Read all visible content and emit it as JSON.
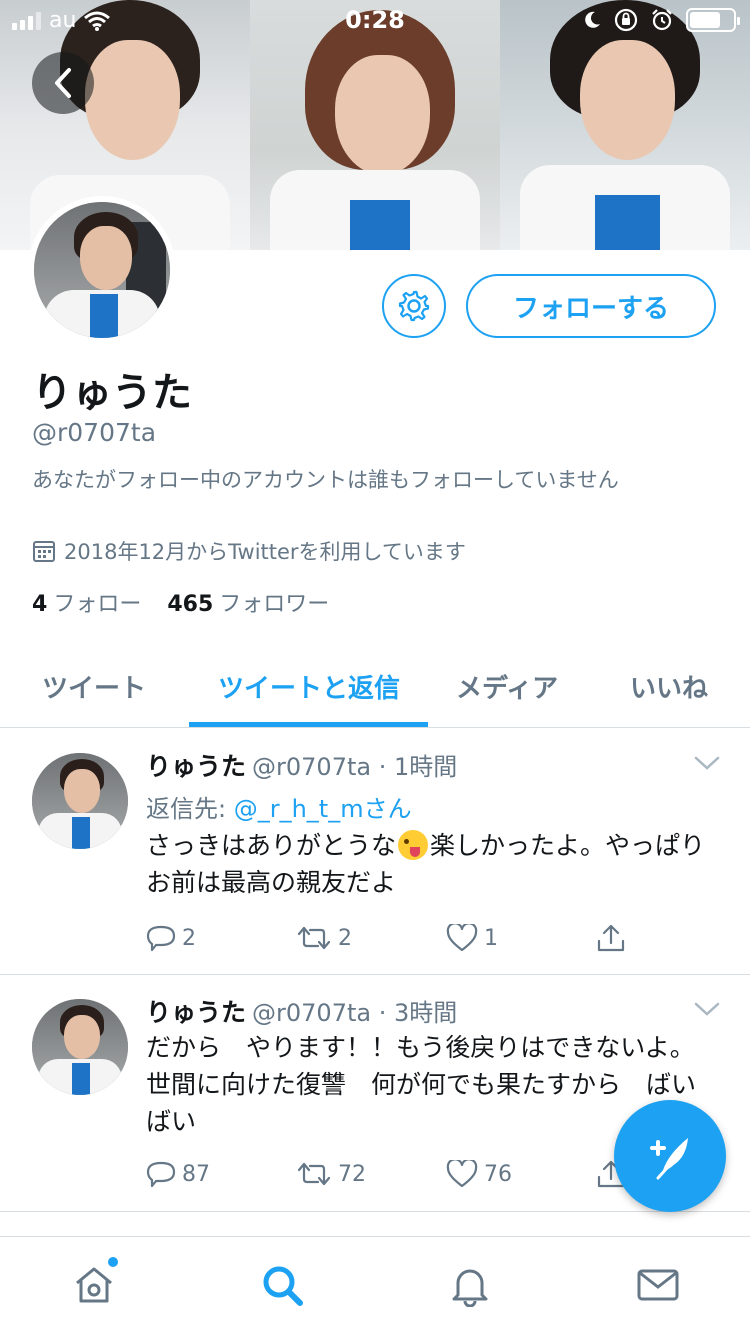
{
  "status_bar": {
    "carrier": "au",
    "time": "0:28"
  },
  "profile": {
    "display_name": "りゅうた",
    "handle": "@r0707ta",
    "follow_note": "あなたがフォロー中のアカウントは誰もフォローしていません",
    "joined": "2018年12月からTwitterを利用しています",
    "following_count": "4",
    "following_label": "フォロー",
    "followers_count": "465",
    "followers_label": "フォロワー",
    "follow_button": "フォローする"
  },
  "tabs": [
    {
      "label": "ツイート"
    },
    {
      "label": "ツイートと返信"
    },
    {
      "label": "メディア"
    },
    {
      "label": "いいね"
    }
  ],
  "active_tab": "ツイートと返信",
  "tweets": [
    {
      "name": "りゅうた",
      "meta": "@r0707ta · 1時間",
      "reply_prefix": "返信先: ",
      "reply_to": "@_r_h_t_mさん",
      "text_before_emoji": "さっきはありがとうな",
      "text_after_emoji": "楽しかったよ。やっぱりお前は最高の親友だよ",
      "replies": "2",
      "retweets": "2",
      "likes": "1"
    },
    {
      "name": "りゅうた",
      "meta": "@r0707ta · 3時間",
      "text": "だから　やります！！もう後戻りはできないよ。世間に向けた復讐　何が何でも果たすから　ばいばい",
      "replies": "87",
      "retweets": "72",
      "likes": "76"
    }
  ],
  "colors": {
    "accent": "#1da1f2",
    "text": "#14171a",
    "muted": "#657786",
    "divider": "#d8dde1"
  },
  "icons": [
    "back-icon",
    "gear-icon",
    "calendar-icon",
    "chevron-down-icon",
    "reply-icon",
    "retweet-icon",
    "like-icon",
    "share-icon",
    "compose-icon",
    "home-icon",
    "search-icon",
    "notifications-icon",
    "messages-icon"
  ]
}
